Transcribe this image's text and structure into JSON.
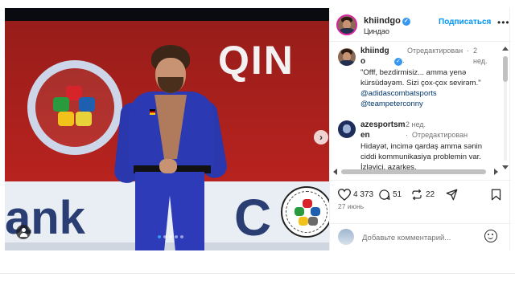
{
  "post": {
    "username": "khiindgo",
    "location": "Циндао",
    "follow_label": "Подписаться",
    "more_label": "•••"
  },
  "photo": {
    "banner_word_top": "QIN",
    "banner_word_left": "ank",
    "banner_word_right": "C",
    "carousel_dots": 5,
    "active_dot": 1
  },
  "comments": [
    {
      "username_line1": "khiindg",
      "username_line2": "o",
      "edited": "Отредактирован",
      "separator": "·",
      "time": "2",
      "time_unit": "нед.",
      "text": "\"Offf, bezdirmisiz... amma yenə kürsüdəyəm. Sizi çox-çox sevirəm.\"",
      "mentions": [
        "@adidascombatsports",
        "@teampeterconny"
      ]
    },
    {
      "username_line1": "azesportsm",
      "username_line2": "en",
      "time": "2 нед.",
      "separator": "·",
      "edited": "Отредактирован",
      "text": "Hidayət, incimə qardaş amma sənin ciddi kommunikasiya problemin var. İzləyici, azarkeş,"
    }
  ],
  "actions": {
    "likes": "4 373",
    "comments": "51",
    "reposts": "22"
  },
  "date": "27 июнь",
  "add_comment": {
    "placeholder": "Добавьте комментарий..."
  },
  "colors": {
    "link": "#00376b",
    "follow": "#0095f6",
    "verified": "#3897f0",
    "meta": "#737373"
  }
}
